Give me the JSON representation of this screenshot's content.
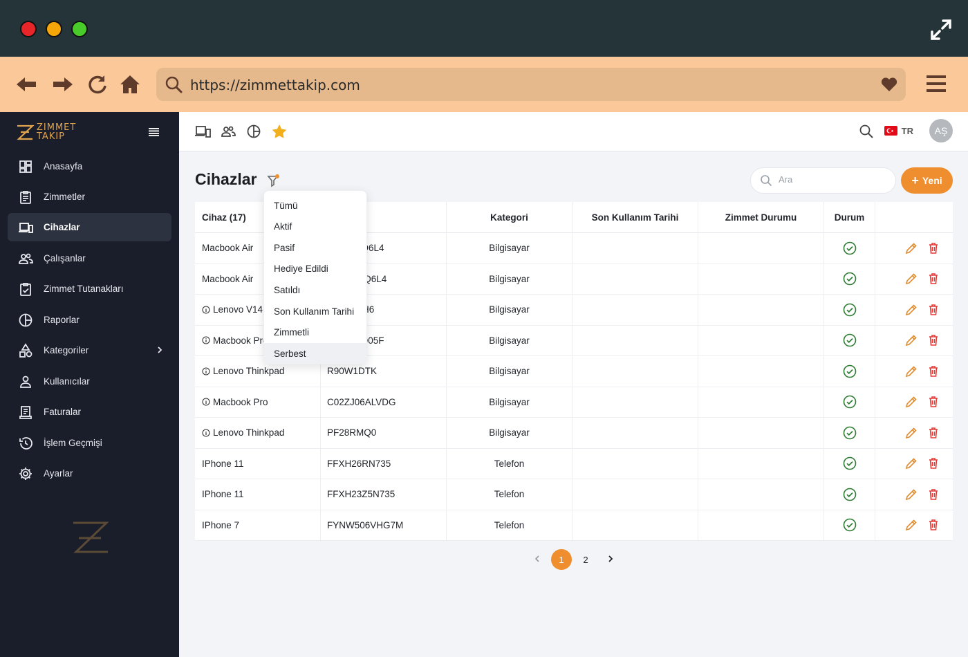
{
  "browser": {
    "url": "https://zimmettakip.com"
  },
  "brand": {
    "line1": "ZIMMET",
    "line2": "TAKIP"
  },
  "sidebar": {
    "items": [
      {
        "label": "Anasayfa"
      },
      {
        "label": "Zimmetler"
      },
      {
        "label": "Cihazlar"
      },
      {
        "label": "Çalışanlar"
      },
      {
        "label": "Zimmet Tutanakları"
      },
      {
        "label": "Raporlar"
      },
      {
        "label": "Kategoriler"
      },
      {
        "label": "Kullanıcılar"
      },
      {
        "label": "Faturalar"
      },
      {
        "label": "İşlem Geçmişi"
      },
      {
        "label": "Ayarlar"
      }
    ]
  },
  "topbar": {
    "language": "TR",
    "avatar_initials": "AŞ"
  },
  "page": {
    "title": "Cihazlar",
    "search_placeholder": "Ara",
    "new_button": "Yeni"
  },
  "table": {
    "headers": [
      "Cihaz (17)",
      "",
      "Kategori",
      "Son Kullanım Tarihi",
      "Zimmet Durumu",
      "Durum",
      ""
    ],
    "rows": [
      {
        "device": "Macbook Air",
        "serial": "C02FB1Q6L4",
        "category": "Bilgisayar",
        "info": false
      },
      {
        "device": "Macbook Air",
        "serial": "C02FNGQ6L4",
        "category": "Bilgisayar",
        "info": false
      },
      {
        "device": "Lenovo V14",
        "serial": "PF3A5HH6",
        "category": "Bilgisayar",
        "info": true
      },
      {
        "device": "Macbook Pro",
        "serial": "C02DJ7Q05F",
        "category": "Bilgisayar",
        "info": true
      },
      {
        "device": "Lenovo Thinkpad",
        "serial": "R90W1DTK",
        "category": "Bilgisayar",
        "info": true
      },
      {
        "device": "Macbook Pro",
        "serial": "C02ZJ06ALVDG",
        "category": "Bilgisayar",
        "info": true
      },
      {
        "device": "Lenovo Thinkpad",
        "serial": "PF28RMQ0",
        "category": "Bilgisayar",
        "info": true
      },
      {
        "device": "IPhone 11",
        "serial": "FFXH26RN735",
        "category": "Telefon",
        "info": false
      },
      {
        "device": "IPhone 11",
        "serial": "FFXH23Z5N735",
        "category": "Telefon",
        "info": false
      },
      {
        "device": "IPhone 7",
        "serial": "FYNW506VHG7M",
        "category": "Telefon",
        "info": false
      }
    ]
  },
  "filter_menu": {
    "options": [
      "Tümü",
      "Aktif",
      "Pasif",
      "Hediye Edildi",
      "Satıldı",
      "Son Kullanım Tarihi",
      "Zimmetli",
      "Serbest"
    ],
    "highlighted": "Serbest"
  },
  "pagination": {
    "pages": [
      "1",
      "2"
    ],
    "current": "1"
  },
  "colors": {
    "accent": "#ef8e2e",
    "sidebar_bg": "#1a1d2a",
    "titlebar_bg": "#253438",
    "navbar_bg": "#fbc89a",
    "status_ok": "#2e7d32",
    "delete": "#e53935",
    "edit": "#e08a2c"
  }
}
